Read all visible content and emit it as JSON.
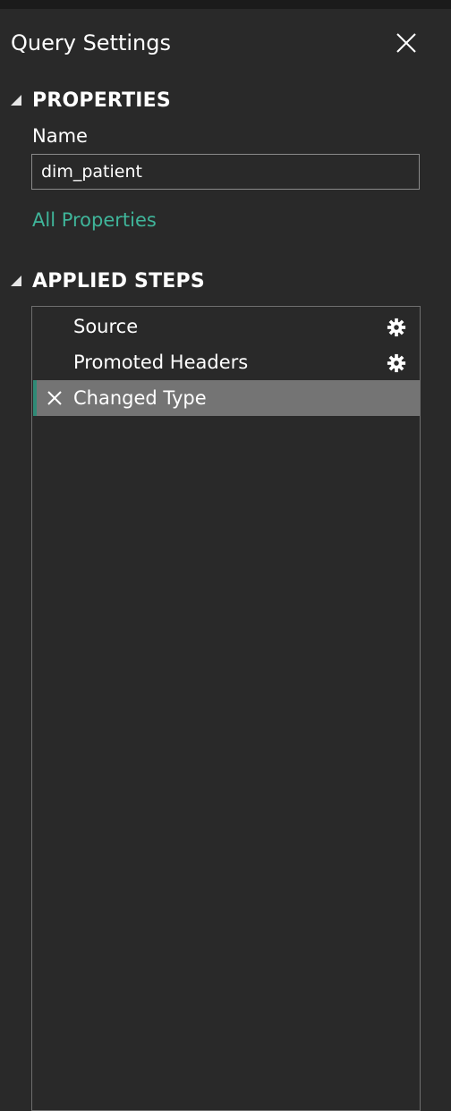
{
  "pane": {
    "title": "Query Settings"
  },
  "properties": {
    "header": "PROPERTIES",
    "name_label": "Name",
    "name_value": "dim_patient",
    "all_properties_link": "All Properties"
  },
  "applied_steps": {
    "header": "APPLIED STEPS",
    "steps": [
      {
        "label": "Source",
        "icon": "gear-icon",
        "selected": false
      },
      {
        "label": "Promoted Headers",
        "icon": "gear-icon",
        "selected": false
      },
      {
        "label": "Changed Type",
        "icon": "delete-step-icon",
        "selected": true
      }
    ]
  },
  "colors": {
    "background": "#292929",
    "accent": "#3fb59a",
    "selected_row": "#747474",
    "selection_bar": "#2f8a76"
  }
}
